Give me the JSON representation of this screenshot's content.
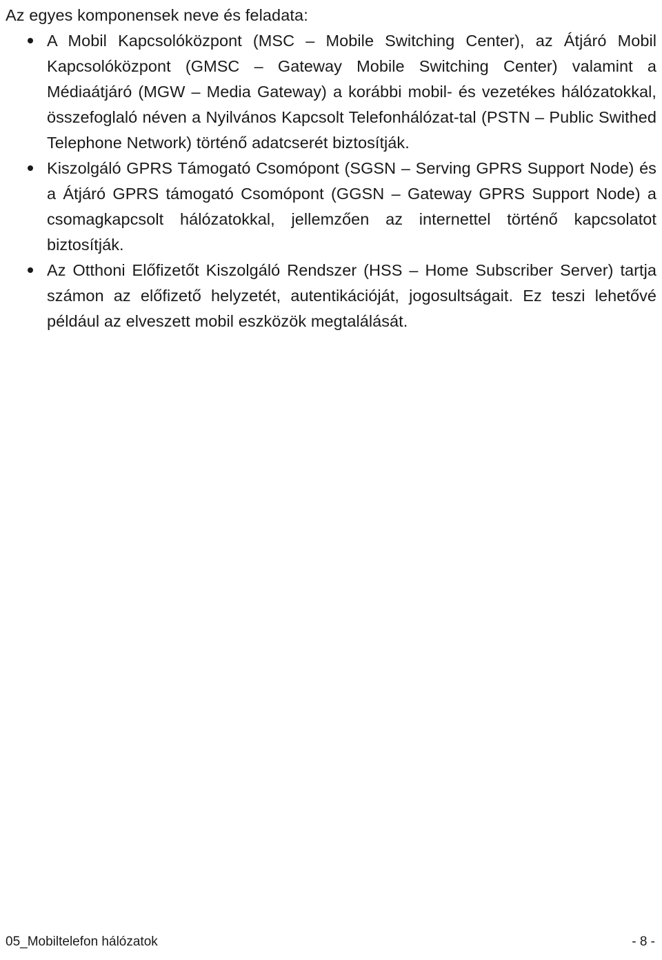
{
  "document": {
    "language": "hu",
    "background_color": "#ffffff",
    "text_color": "#1a1a1a"
  },
  "body": {
    "intro": "Az egyes komponensek neve és feladata:",
    "bullets": [
      {
        "marker": "bullet-dot",
        "text": "A Mobil Kapcsolóközpont (MSC – Mobile Switching Center), az Átjáró Mobil Kapcsolóközpont (GMSC – Gateway Mobile Switching Center) valamint a Médiaátjáró (MGW – Media Gateway) a korábbi mobil- és vezetékes hálózatokkal, összefoglaló néven a Nyilvános Kapcsolt Telefonhálózat-tal (PSTN – Public Swithed Telephone Network) történő adatcserét biztosítják."
      },
      {
        "marker": "bullet-dot",
        "text": "Kiszolgáló GPRS Támogató Csomópont (SGSN – Serving GPRS Support Node) és a Átjáró GPRS támogató Csomópont (GGSN – Gateway GPRS Support Node) a csomagkapcsolt hálózatokkal, jellemzően az internettel történő kapcsolatot biztosítják."
      },
      {
        "marker": "bullet-dot",
        "text": "Az Otthoni Előfizetőt Kiszolgáló Rendszer (HSS – Home Subscriber Server) tartja számon az előfizető helyzetét, autentikációját, jogosultságait. Ez teszi lehetővé például az elveszett mobil eszközök megtalálását."
      }
    ]
  },
  "footer": {
    "document_title": "05_Mobiltelefon hálózatok",
    "page_number": "- 8 -"
  }
}
